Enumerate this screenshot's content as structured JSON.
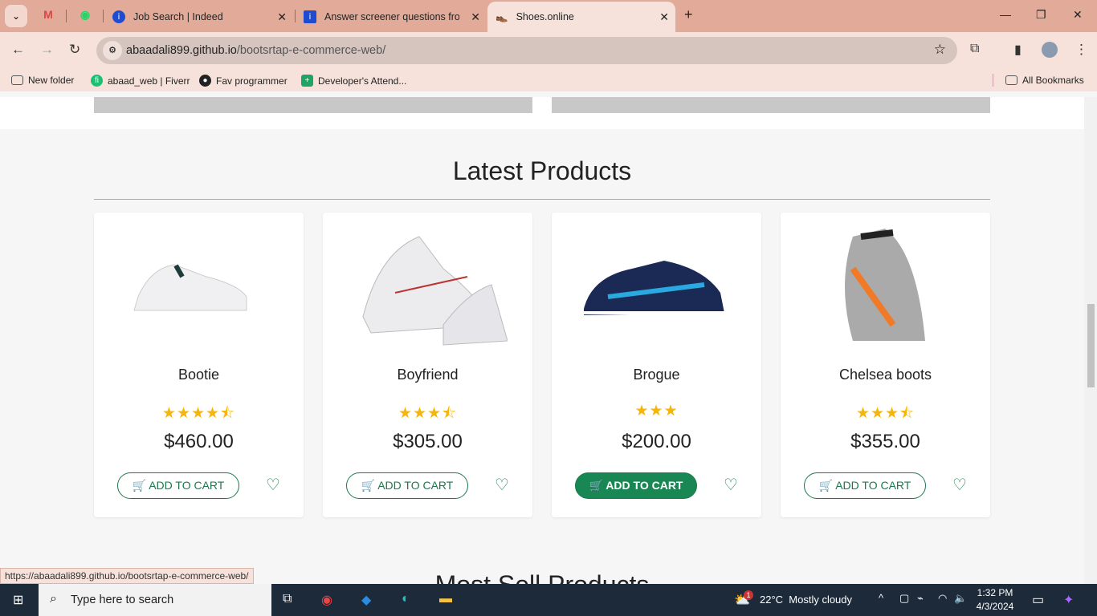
{
  "browser": {
    "tabs": [
      {
        "title": "Job Search | Indeed",
        "icon": "indeed-icon"
      },
      {
        "title": "Answer screener questions from",
        "icon": "indeed-icon"
      },
      {
        "title": "Shoes.online",
        "icon": "shoe-favicon",
        "active": true
      }
    ],
    "pinned": [
      "gmail-icon",
      "whatsapp-icon"
    ],
    "url_host": "abaadali899.github.io",
    "url_path": "/bootsrtap-e-commerce-web/",
    "bookmarks": [
      {
        "label": "New folder",
        "icon": "folder-icon"
      },
      {
        "label": "abaad_web | Fiverr",
        "icon": "fiverr-icon"
      },
      {
        "label": "Fav programmer",
        "icon": "github-icon"
      },
      {
        "label": "Developer's Attend...",
        "icon": "sheets-icon"
      }
    ],
    "all_bookmarks": "All Bookmarks",
    "status_url": "https://abaadali899.github.io/bootsrtap-e-commerce-web/"
  },
  "section": {
    "title": "Latest Products",
    "next_title": "Most Sell Products"
  },
  "products": [
    {
      "name": "Bootie",
      "rating": 4.5,
      "stars": "★★★★⯪",
      "price": "$460.00",
      "cta": "🛒 ADD TO CART",
      "highlight": false
    },
    {
      "name": "Boyfriend",
      "rating": 3.5,
      "stars": "★★★⯪",
      "price": "$305.00",
      "cta": "🛒 ADD TO CART",
      "highlight": false
    },
    {
      "name": "Brogue",
      "rating": 3,
      "stars": "★★★",
      "price": "$200.00",
      "cta": "🛒 ADD TO CART",
      "highlight": true
    },
    {
      "name": "Chelsea boots",
      "rating": 3.5,
      "stars": "★★★⯪",
      "price": "$355.00",
      "cta": "🛒 ADD TO CART",
      "highlight": false
    }
  ],
  "taskbar": {
    "search_placeholder": "Type here to search",
    "weather": "22°C  Mostly cloudy",
    "time": "1:32 PM",
    "date": "4/3/2024",
    "weather_badge": "1"
  },
  "colors": {
    "accent": "#198754",
    "star": "#f5b50a",
    "tabbar": "#e2ab99"
  }
}
